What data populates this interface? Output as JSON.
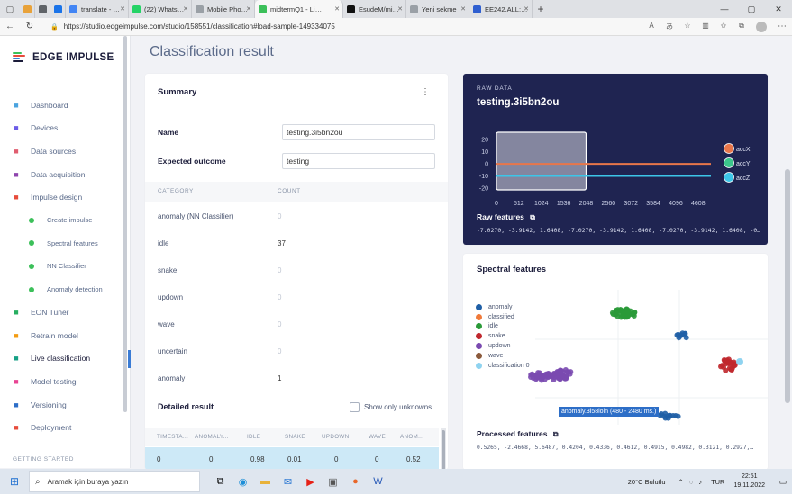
{
  "browser": {
    "tabs": [
      {
        "label": "",
        "icon": "bookmark-icon",
        "color": "#e8a23a"
      },
      {
        "label": "",
        "icon": "square-icon",
        "color": "#5f6368"
      },
      {
        "label": "",
        "icon": "circle-icon",
        "color": "#1a73e8"
      },
      {
        "label": "translate - Google S",
        "icon": "google-icon",
        "color": "#4285f4"
      },
      {
        "label": "(22) WhatsApp",
        "icon": "whatsapp-icon",
        "color": "#25d366"
      },
      {
        "label": "Mobile Phone - Edge",
        "icon": "document-icon",
        "color": "#9aa0a6"
      },
      {
        "label": "midtermQ1 - Live c",
        "icon": "edge-impulse-icon",
        "color": "#3cc05a"
      },
      {
        "label": "EsudeM/midtermq",
        "icon": "github-icon",
        "color": "#111111"
      },
      {
        "label": "Yeni sekme",
        "icon": "newtab-icon",
        "color": "#9aa0a6"
      },
      {
        "label": "EE242.ALL: Midterm",
        "icon": "moodle-icon",
        "color": "#2f5fd0"
      }
    ],
    "url": "https://studio.edgeimpulse.com/studio/158551/classification#load-sample-149334075"
  },
  "logo": {
    "text": "EDGE IMPULSE"
  },
  "nav": [
    {
      "label": "Dashboard",
      "icon": "monitor-icon",
      "color": "#4aa3df",
      "sub": false
    },
    {
      "label": "Devices",
      "icon": "devices-icon",
      "color": "#6c5ce7",
      "sub": false
    },
    {
      "label": "Data sources",
      "icon": "data-sources-icon",
      "color": "#e05d6f",
      "sub": false
    },
    {
      "label": "Data acquisition",
      "icon": "database-icon",
      "color": "#8e44ad",
      "sub": false
    },
    {
      "label": "Impulse design",
      "icon": "impulse-icon",
      "color": "#e74c3c",
      "sub": false
    },
    {
      "label": "Create impulse",
      "sub": true
    },
    {
      "label": "Spectral features",
      "sub": true
    },
    {
      "label": "NN Classifier",
      "sub": true
    },
    {
      "label": "Anomaly detection",
      "sub": true
    },
    {
      "label": "EON Tuner",
      "icon": "eon-icon",
      "color": "#27ae60",
      "sub": false
    },
    {
      "label": "Retrain model",
      "icon": "retrain-icon",
      "color": "#f39c12",
      "sub": false
    },
    {
      "label": "Live classification",
      "icon": "live-icon",
      "color": "#16a085",
      "sub": false,
      "active": true
    },
    {
      "label": "Model testing",
      "icon": "testing-icon",
      "color": "#e84393",
      "sub": false
    },
    {
      "label": "Versioning",
      "icon": "versioning-icon",
      "color": "#2d6ec7",
      "sub": false
    },
    {
      "label": "Deployment",
      "icon": "deployment-icon",
      "color": "#e74c3c",
      "sub": false
    }
  ],
  "sidebar_footer": "GETTING STARTED",
  "page_title": "Classification result",
  "summary": {
    "title": "Summary",
    "name_label": "Name",
    "name_value": "testing.3i5bn2ou",
    "expected_label": "Expected outcome",
    "expected_value": "testing",
    "col_category": "CATEGORY",
    "col_count": "COUNT",
    "rows": [
      {
        "category": "anomaly (NN Classifier)",
        "count": "0"
      },
      {
        "category": "idle",
        "count": "37"
      },
      {
        "category": "snake",
        "count": "0"
      },
      {
        "category": "updown",
        "count": "0"
      },
      {
        "category": "wave",
        "count": "0"
      },
      {
        "category": "uncertain",
        "count": "0"
      },
      {
        "category": "anomaly",
        "count": "1"
      }
    ]
  },
  "detailed": {
    "title": "Detailed result",
    "show_unknowns": "Show only unknowns",
    "headers": [
      "TIMESTA...",
      "ANOMALY...",
      "IDLE",
      "SNAKE",
      "UPDOWN",
      "WAVE",
      "ANOM..."
    ],
    "row": [
      "0",
      "0",
      "0.98",
      "0.01",
      "0",
      "0",
      "0.52"
    ]
  },
  "raw": {
    "label": "RAW DATA",
    "name": "testing.3i5bn2ou",
    "features_title": "Raw features",
    "features_values": "-7.0270, -3.9142, 1.6408, -7.0270, -3.9142, 1.6408, -7.0270, -3.9142, 1.6408, -0…",
    "colors": {
      "accX": "#e8764a",
      "accY": "#3cc58b",
      "accZ": "#3cc6e8"
    }
  },
  "chart_data": {
    "type": "line",
    "x_ticks": [
      "0",
      "512",
      "1024",
      "1536",
      "2048",
      "2560",
      "3072",
      "3584",
      "4096",
      "4608"
    ],
    "y_ticks": [
      "20",
      "10",
      "0",
      "-10",
      "-20"
    ],
    "xlim": [
      0,
      4900
    ],
    "ylim": [
      -24,
      24
    ],
    "series": [
      {
        "name": "accX",
        "values": [
          -0.5,
          -0.5,
          -0.5,
          -0.5,
          -0.5,
          -0.5,
          -0.5,
          -0.5,
          -0.5,
          -0.5
        ]
      },
      {
        "name": "accY",
        "values": [
          -10,
          -10,
          -10,
          -10,
          -10,
          -10,
          -10,
          -10,
          -10,
          -10
        ]
      },
      {
        "name": "accZ",
        "values": [
          -10.3,
          -10.3,
          -10.3,
          -10.3,
          -10.3,
          -10.3,
          -10.3,
          -10.3,
          -10.3,
          -10.3
        ]
      }
    ],
    "x": [
      0,
      512,
      1024,
      1536,
      2048,
      2560,
      3072,
      3584,
      4096,
      4608
    ],
    "window": [
      0,
      2048
    ],
    "legend": "right"
  },
  "spectral": {
    "title": "Spectral features",
    "legend": [
      {
        "label": "anomaly",
        "color": "#1f5fa6"
      },
      {
        "label": "classified",
        "color": "#f07a3a"
      },
      {
        "label": "idle",
        "color": "#2a9a38"
      },
      {
        "label": "snake",
        "color": "#c0282e"
      },
      {
        "label": "updown",
        "color": "#7a4ab0"
      },
      {
        "label": "wave",
        "color": "#8b5a3c"
      },
      {
        "label": "classification 0",
        "color": "#8fd3f0"
      }
    ],
    "tooltip": "anomaly.3i58loin (480 - 2480 ms.)",
    "processed_title": "Processed features",
    "processed_values": "0.5265, -2.4668, 5.6487, 0.4204, 0.4336, 0.4612, 0.4915, 0.4982, 0.3121, 0.2927,…"
  },
  "taskbar": {
    "search_placeholder": "Aramak için buraya yazın",
    "weather": "20°C  Bulutlu",
    "lang": "TUR",
    "time": "22:51",
    "date": "19.11.2022"
  }
}
